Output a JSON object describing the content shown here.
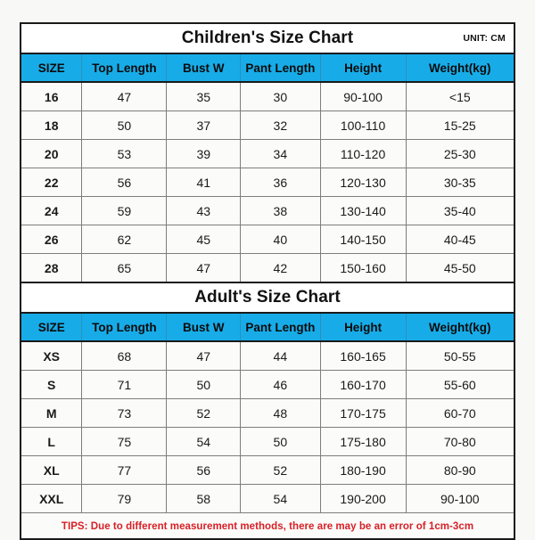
{
  "unit_label": "UNIT: CM",
  "columns": [
    "SIZE",
    "Top Length",
    "Bust W",
    "Pant Length",
    "Height",
    "Weight(kg)"
  ],
  "children": {
    "title": "Children's Size Chart",
    "unit": "UNIT: CM",
    "headers": [
      "SIZE",
      "Top Length",
      "Bust W",
      "Pant Length",
      "Height",
      "Weight(kg)"
    ],
    "rows": [
      [
        "16",
        "47",
        "35",
        "30",
        "90-100",
        "<15"
      ],
      [
        "18",
        "50",
        "37",
        "32",
        "100-110",
        "15-25"
      ],
      [
        "20",
        "53",
        "39",
        "34",
        "110-120",
        "25-30"
      ],
      [
        "22",
        "56",
        "41",
        "36",
        "120-130",
        "30-35"
      ],
      [
        "24",
        "59",
        "43",
        "38",
        "130-140",
        "35-40"
      ],
      [
        "26",
        "62",
        "45",
        "40",
        "140-150",
        "40-45"
      ],
      [
        "28",
        "65",
        "47",
        "42",
        "150-160",
        "45-50"
      ]
    ]
  },
  "adult": {
    "title": "Adult's Size Chart",
    "headers": [
      "SIZE",
      "Top Length",
      "Bust W",
      "Pant Length",
      "Height",
      "Weight(kg)"
    ],
    "rows": [
      [
        "XS",
        "68",
        "47",
        "44",
        "160-165",
        "50-55"
      ],
      [
        "S",
        "71",
        "50",
        "46",
        "160-170",
        "55-60"
      ],
      [
        "M",
        "73",
        "52",
        "48",
        "170-175",
        "60-70"
      ],
      [
        "L",
        "75",
        "54",
        "50",
        "175-180",
        "70-80"
      ],
      [
        "XL",
        "77",
        "56",
        "52",
        "180-190",
        "80-90"
      ],
      [
        "XXL",
        "79",
        "58",
        "54",
        "190-200",
        "90-100"
      ]
    ]
  },
  "tips": "TIPS: Due to different measurement methods, there are may be an error of 1cm-3cm",
  "colors": {
    "header_blue": "#17ace8",
    "tips_red": "#d81f26",
    "border_dark": "#1a1a1a",
    "border_light": "#7d7d7d",
    "page_background": "#f8f8f6",
    "cell_background": "#fbfbf9"
  },
  "chart_data": {
    "type": "table",
    "title": "Children's and Adult's Size Chart",
    "unit": "CM",
    "tables": [
      {
        "name": "Children's Size Chart",
        "columns": [
          "SIZE",
          "Top Length",
          "Bust W",
          "Pant Length",
          "Height",
          "Weight(kg)"
        ],
        "rows": [
          [
            "16",
            "47",
            "35",
            "30",
            "90-100",
            "<15"
          ],
          [
            "18",
            "50",
            "37",
            "32",
            "100-110",
            "15-25"
          ],
          [
            "20",
            "53",
            "39",
            "34",
            "110-120",
            "25-30"
          ],
          [
            "22",
            "56",
            "41",
            "36",
            "120-130",
            "30-35"
          ],
          [
            "24",
            "59",
            "43",
            "38",
            "130-140",
            "35-40"
          ],
          [
            "26",
            "62",
            "45",
            "40",
            "140-150",
            "40-45"
          ],
          [
            "28",
            "65",
            "47",
            "42",
            "150-160",
            "45-50"
          ]
        ]
      },
      {
        "name": "Adult's Size Chart",
        "columns": [
          "SIZE",
          "Top Length",
          "Bust W",
          "Pant Length",
          "Height",
          "Weight(kg)"
        ],
        "rows": [
          [
            "XS",
            "68",
            "47",
            "44",
            "160-165",
            "50-55"
          ],
          [
            "S",
            "71",
            "50",
            "46",
            "160-170",
            "55-60"
          ],
          [
            "M",
            "73",
            "52",
            "48",
            "170-175",
            "60-70"
          ],
          [
            "L",
            "75",
            "54",
            "50",
            "175-180",
            "70-80"
          ],
          [
            "XL",
            "77",
            "56",
            "52",
            "180-190",
            "80-90"
          ],
          [
            "XXL",
            "79",
            "58",
            "54",
            "190-200",
            "90-100"
          ]
        ]
      }
    ],
    "note": "TIPS: Due to different measurement methods, there are may be an error of 1cm-3cm"
  }
}
